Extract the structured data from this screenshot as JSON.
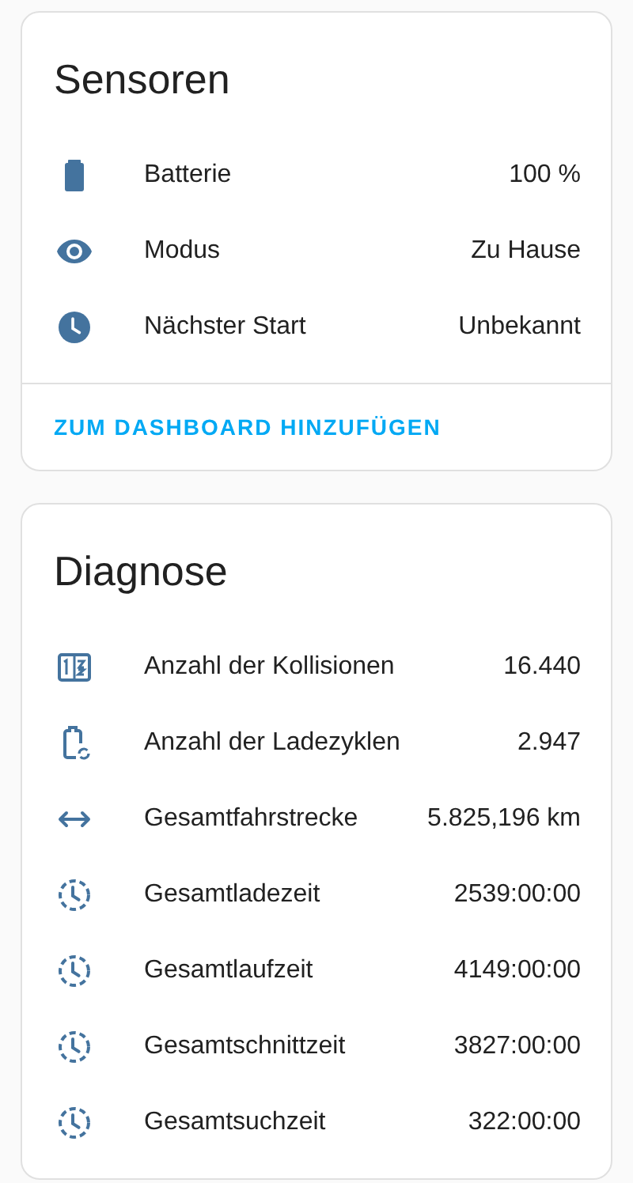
{
  "cards": [
    {
      "title": "Sensoren",
      "rows": [
        {
          "name": "Batterie",
          "value": "100 %"
        },
        {
          "name": "Modus",
          "value": "Zu Hause"
        },
        {
          "name": "Nächster Start",
          "value": "Unbekannt"
        }
      ],
      "action": "ZUM DASHBOARD HINZUFÜGEN"
    },
    {
      "title": "Diagnose",
      "rows": [
        {
          "name": "Anzahl der Kollisionen",
          "value": "16.440"
        },
        {
          "name": "Anzahl der Ladezyklen",
          "value": "2.947"
        },
        {
          "name": "Gesamtfahrstrecke",
          "value": "5.825,196 km"
        },
        {
          "name": "Gesamtladezeit",
          "value": "2539:00:00"
        },
        {
          "name": "Gesamtlaufzeit",
          "value": "4149:00:00"
        },
        {
          "name": "Gesamtschnittzeit",
          "value": "3827:00:00"
        },
        {
          "name": "Gesamtsuchzeit",
          "value": "322:00:00"
        }
      ]
    }
  ]
}
